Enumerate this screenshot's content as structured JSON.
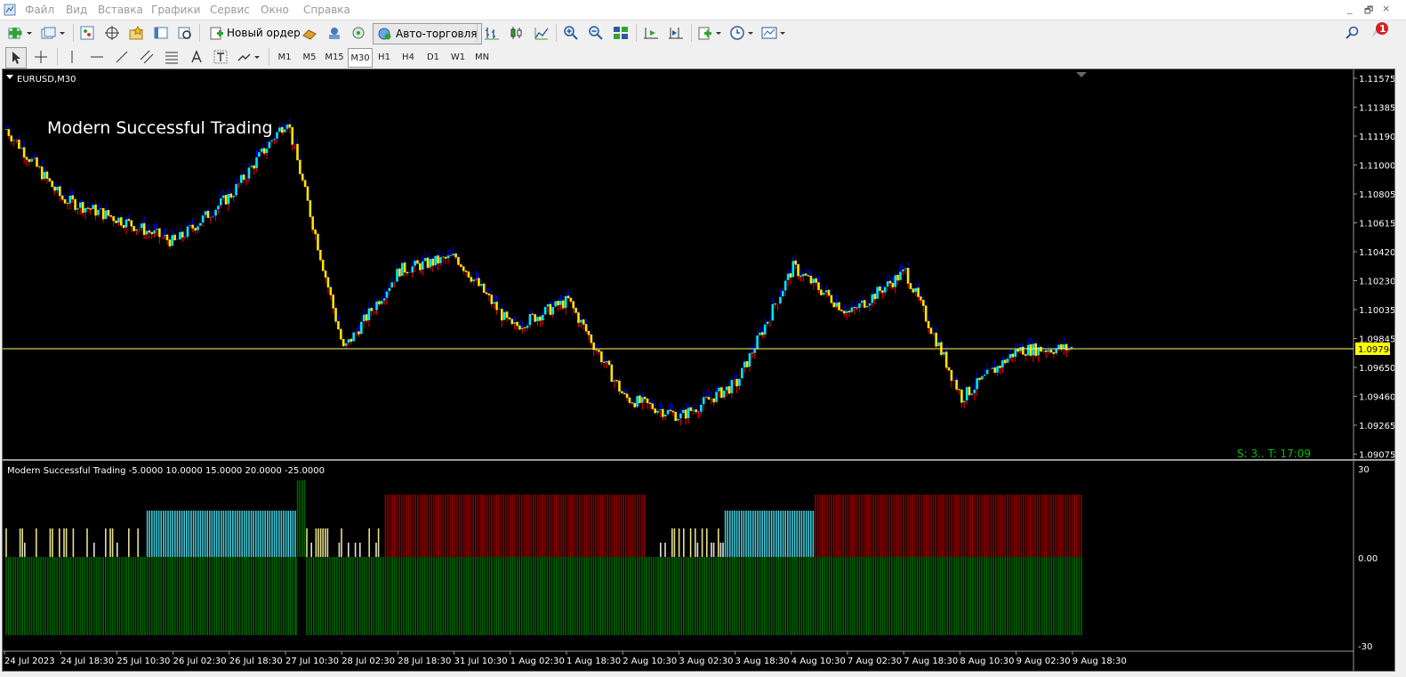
{
  "menu": {
    "items": [
      "Файл",
      "Вид",
      "Вставка",
      "Графики",
      "Сервис",
      "Окно",
      "Справка"
    ],
    "window_controls": [
      "_",
      "🗗",
      "×"
    ]
  },
  "toolbar": {
    "new_order": "Новый ордер",
    "auto_trading": "Авто-торговля",
    "notification_count": "1",
    "timeframes": [
      "M1",
      "M5",
      "M15",
      "M30",
      "H1",
      "H4",
      "D1",
      "W1",
      "MN"
    ],
    "active_timeframe": "M30"
  },
  "chart": {
    "symbol_label": "EURUSD,M30",
    "overlay_title": "Modern Successful Trading",
    "price_axis": [
      "1.11575",
      "1.11385",
      "1.11190",
      "1.11000",
      "1.10805",
      "1.10615",
      "1.10420",
      "1.10230",
      "1.10035",
      "1.09845",
      "1.09650",
      "1.09460",
      "1.09265",
      "1.09075"
    ],
    "current_price": "1.09794",
    "status_text": "S: 3.. T: 17:09",
    "time_axis": [
      "24 Jul 2023",
      "24 Jul 18:30",
      "25 Jul 10:30",
      "26 Jul 02:30",
      "26 Jul 18:30",
      "27 Jul 10:30",
      "28 Jul 02:30",
      "28 Jul 18:30",
      "31 Jul 10:30",
      "1 Aug 02:30",
      "1 Aug 18:30",
      "2 Aug 10:30",
      "3 Aug 02:30",
      "3 Aug 18:30",
      "4 Aug 10:30",
      "7 Aug 02:30",
      "7 Aug 18:30",
      "8 Aug 10:30",
      "9 Aug 02:30",
      "9 Aug 18:30"
    ],
    "colors": {
      "bull": "#00e5ff",
      "bear": "#ffe600",
      "wick_up": "#0000ff",
      "wick_down": "#ff0000",
      "price_line": "#ffff66",
      "status": "#00c000"
    }
  },
  "indicator": {
    "label": "Modern Successful Trading -5.0000 10.0000 15.0000 20.0000 -25.0000",
    "axis": [
      "30",
      "0.00",
      "-30"
    ],
    "colors": {
      "green": "#006400",
      "red": "#8b0000",
      "cyan": "#40c8d8",
      "yellow": "#e6e08c",
      "white": "#e0e0e0"
    }
  },
  "chart_data": {
    "type": "line",
    "title": "Modern Successful Trading",
    "x": [
      "24 Jul 2023",
      "24 Jul 18:30",
      "25 Jul 10:30",
      "26 Jul 02:30",
      "26 Jul 18:30",
      "27 Jul 10:30",
      "28 Jul 02:30",
      "28 Jul 18:30",
      "31 Jul 10:30",
      "1 Aug 02:30",
      "1 Aug 18:30",
      "2 Aug 10:30",
      "3 Aug 02:30",
      "3 Aug 18:30",
      "4 Aug 10:30",
      "7 Aug 02:30",
      "7 Aug 18:30",
      "8 Aug 10:30",
      "9 Aug 02:30",
      "9 Aug 18:30"
    ],
    "series": [
      {
        "name": "EURUSD,M30",
        "values": [
          1.113,
          1.1082,
          1.1068,
          1.1052,
          1.1085,
          1.1137,
          1.0978,
          1.1033,
          1.1042,
          1.0993,
          1.1012,
          1.0945,
          1.0932,
          1.0955,
          1.1035,
          1.1003,
          1.1032,
          1.0945,
          1.0978,
          1.0979
        ]
      }
    ],
    "ylim": [
      1.0906,
      1.1165
    ]
  }
}
